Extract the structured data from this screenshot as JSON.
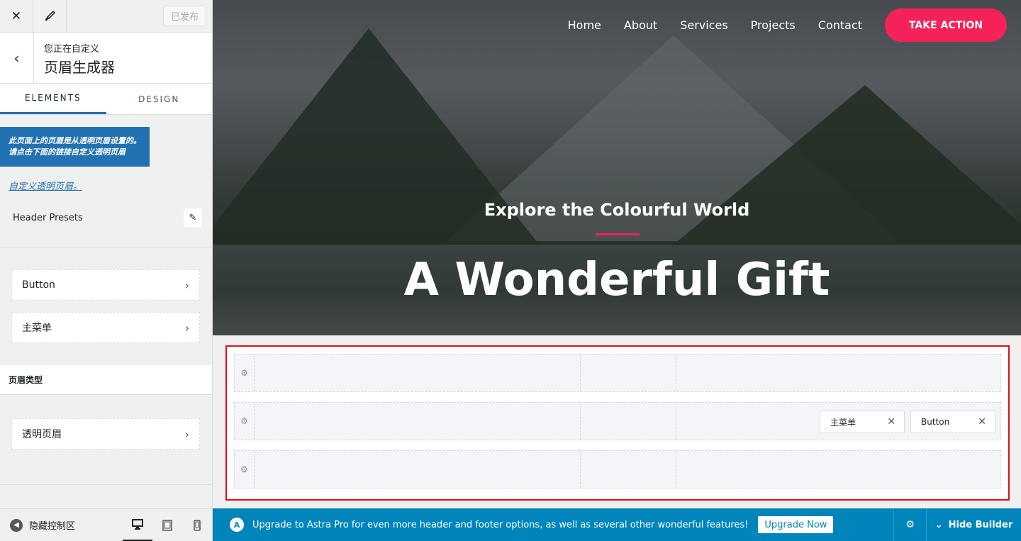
{
  "sidebar": {
    "publish_label": "已发布",
    "context_small": "您正在自定义",
    "context_title": "页眉生成器",
    "tabs": [
      {
        "label": "ELEMENTS"
      },
      {
        "label": "DESIGN"
      }
    ],
    "notice": "此页面上的页眉是从透明页眉设置的。请点击下面的链接自定义透明页眉",
    "notice_link": "自定义透明页眉。",
    "presets_label": "Header Presets",
    "items": [
      {
        "label": "Button"
      },
      {
        "label": "主菜单"
      }
    ],
    "section_title": "页眉类型",
    "section_item": "透明页眉",
    "hide_controls": "隐藏控制区"
  },
  "preview": {
    "nav": [
      {
        "label": "Home"
      },
      {
        "label": "About"
      },
      {
        "label": "Services"
      },
      {
        "label": "Projects"
      },
      {
        "label": "Contact"
      }
    ],
    "cta": "TAKE ACTION",
    "eyebrow": "Explore the Colourful World",
    "headline": "A Wonderful Gift",
    "accent_color": "#f52259"
  },
  "builder": {
    "chips": [
      {
        "label": "主菜单"
      },
      {
        "label": "Button"
      }
    ]
  },
  "upgrade_bar": {
    "message": "Upgrade to Astra Pro for even more header and footer options, as well as several other wonderful features!",
    "button": "Upgrade Now",
    "hide_builder": "Hide Builder"
  },
  "icons": {
    "close": "close-icon",
    "brush": "brush-icon",
    "back": "chevron-left-icon",
    "pencil": "pencil-icon",
    "chevron": "chevron-right-icon",
    "gear": "gear-icon",
    "desktop": "desktop-icon",
    "tablet": "tablet-icon",
    "mobile": "mobile-icon"
  }
}
